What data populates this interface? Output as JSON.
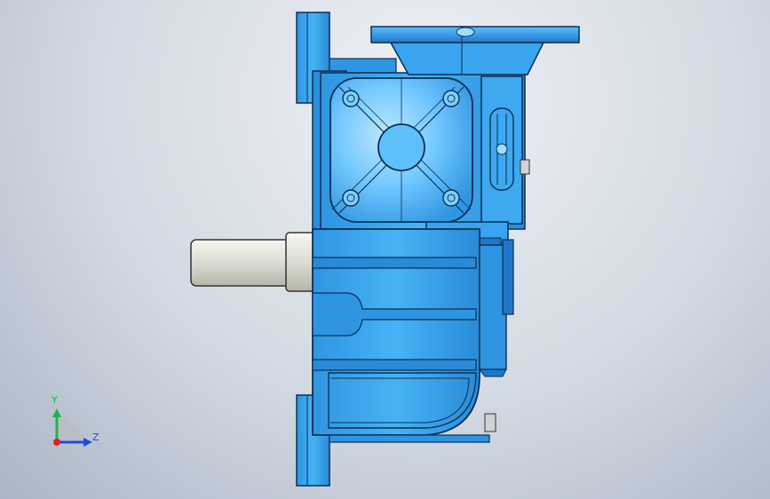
{
  "viewport": {
    "part_color": "#38a6f0",
    "part_dark": "#1c6fb4",
    "shaft_color": "#e8e8e0",
    "background_top": "#eef1f5",
    "background_bottom": "#aab6c5"
  },
  "triad": {
    "y_label": "Y",
    "z_label": "Z",
    "y_color": "#22b14c",
    "z_color": "#1f4fd8",
    "x_color": "#e02020"
  }
}
